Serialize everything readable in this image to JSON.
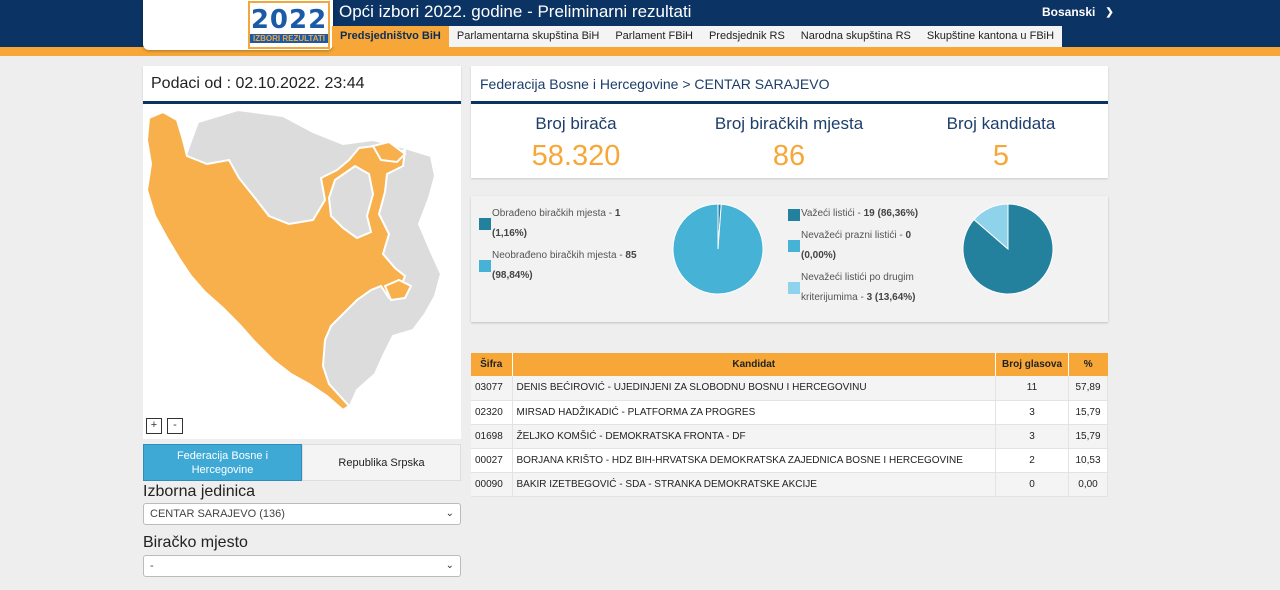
{
  "header": {
    "logo_year": "2022",
    "logo_text": "IZBORI REZULTATI",
    "title": "Opći izbori 2022. godine - Preliminarni rezultati",
    "language": "Bosanski",
    "tabs": [
      {
        "label": "Predsjedništvo BiH",
        "active": true
      },
      {
        "label": "Parlamentarna skupština BiH",
        "active": false
      },
      {
        "label": "Parlament FBiH",
        "active": false
      },
      {
        "label": "Predsjednik RS",
        "active": false
      },
      {
        "label": "Narodna skupština RS",
        "active": false
      },
      {
        "label": "Skupštine kantona u FBiH",
        "active": false
      }
    ]
  },
  "left": {
    "data_from": "Podaci od : 02.10.2022. 23:44",
    "zoom_in": "+",
    "zoom_out": "-",
    "entity_fbih": "Federacija Bosne i Hercegovine",
    "entity_rs": "Republika Srpska",
    "unit_label": "Izborna jedinica",
    "unit_value": "CENTAR SARAJEVO (136)",
    "station_label": "Biračko mjesto",
    "station_value": "-"
  },
  "summary": {
    "breadcrumb": "Federacija Bosne i Hercegovine > CENTAR SARAJEVO",
    "stats": [
      {
        "label": "Broj birača",
        "value": "58.320"
      },
      {
        "label": "Broj biračkih mjesta",
        "value": "86"
      },
      {
        "label": "Broj kandidata",
        "value": "5"
      }
    ]
  },
  "processed": {
    "items": [
      {
        "label": "Obrađeno biračkih mjesta - ",
        "count": "1",
        "pct": "(1,16%)",
        "color": "#23819e",
        "fraction": 0.0116
      },
      {
        "label": "Neobrađeno biračkih mjesta - ",
        "count": "85",
        "pct": "(98,84%)",
        "color": "#45b2d6",
        "fraction": 0.9884
      }
    ]
  },
  "ballots": {
    "items": [
      {
        "label": "Važeći listići - ",
        "count": "19",
        "pct": "(86,36%)",
        "color": "#23819e",
        "fraction": 0.8636
      },
      {
        "label": "Nevažeći prazni listići - ",
        "count": "0",
        "pct": "(0,00%)",
        "color": "#45b2d6",
        "fraction": 0.0
      },
      {
        "label": "Nevažeći listići po drugim kriterijumima - ",
        "label_line1": "Nevažeći listići po drugim",
        "label_line2": "kriterijumima - ",
        "count": "3",
        "pct": "(13,64%)",
        "color": "#8fd3ea",
        "fraction": 0.1364
      }
    ]
  },
  "results": {
    "headers": [
      "Šifra",
      "Kandidat",
      "Broj glasova",
      "%"
    ],
    "rows": [
      {
        "code": "03077",
        "candidate": "DENIS BEĆIROVIĆ - UJEDINJENI ZA SLOBODNU BOSNU I HERCEGOVINU",
        "votes": "11",
        "pct": "57,89"
      },
      {
        "code": "02320",
        "candidate": "MIRSAD HADŽIKADIĆ - PLATFORMA ZA PROGRES",
        "votes": "3",
        "pct": "15,79"
      },
      {
        "code": "01698",
        "candidate": "ŽELJKO KOMŠIĆ - DEMOKRATSKA FRONTA - DF",
        "votes": "3",
        "pct": "15,79"
      },
      {
        "code": "00027",
        "candidate": "BORJANA KRIŠTO - HDZ BIH-HRVATSKA DEMOKRATSKA ZAJEDNICA BOSNE I HERCEGOVINE",
        "votes": "2",
        "pct": "10,53"
      },
      {
        "code": "00090",
        "candidate": "BAKIR IZETBEGOVIĆ - SDA - STRANKA DEMOKRATSKE AKCIJE",
        "votes": "0",
        "pct": "0,00"
      }
    ]
  },
  "colors": {
    "navy": "#0b3363",
    "orange": "#f7a738",
    "map_federation": "#f8b04c",
    "map_other": "#dcdcdc"
  }
}
